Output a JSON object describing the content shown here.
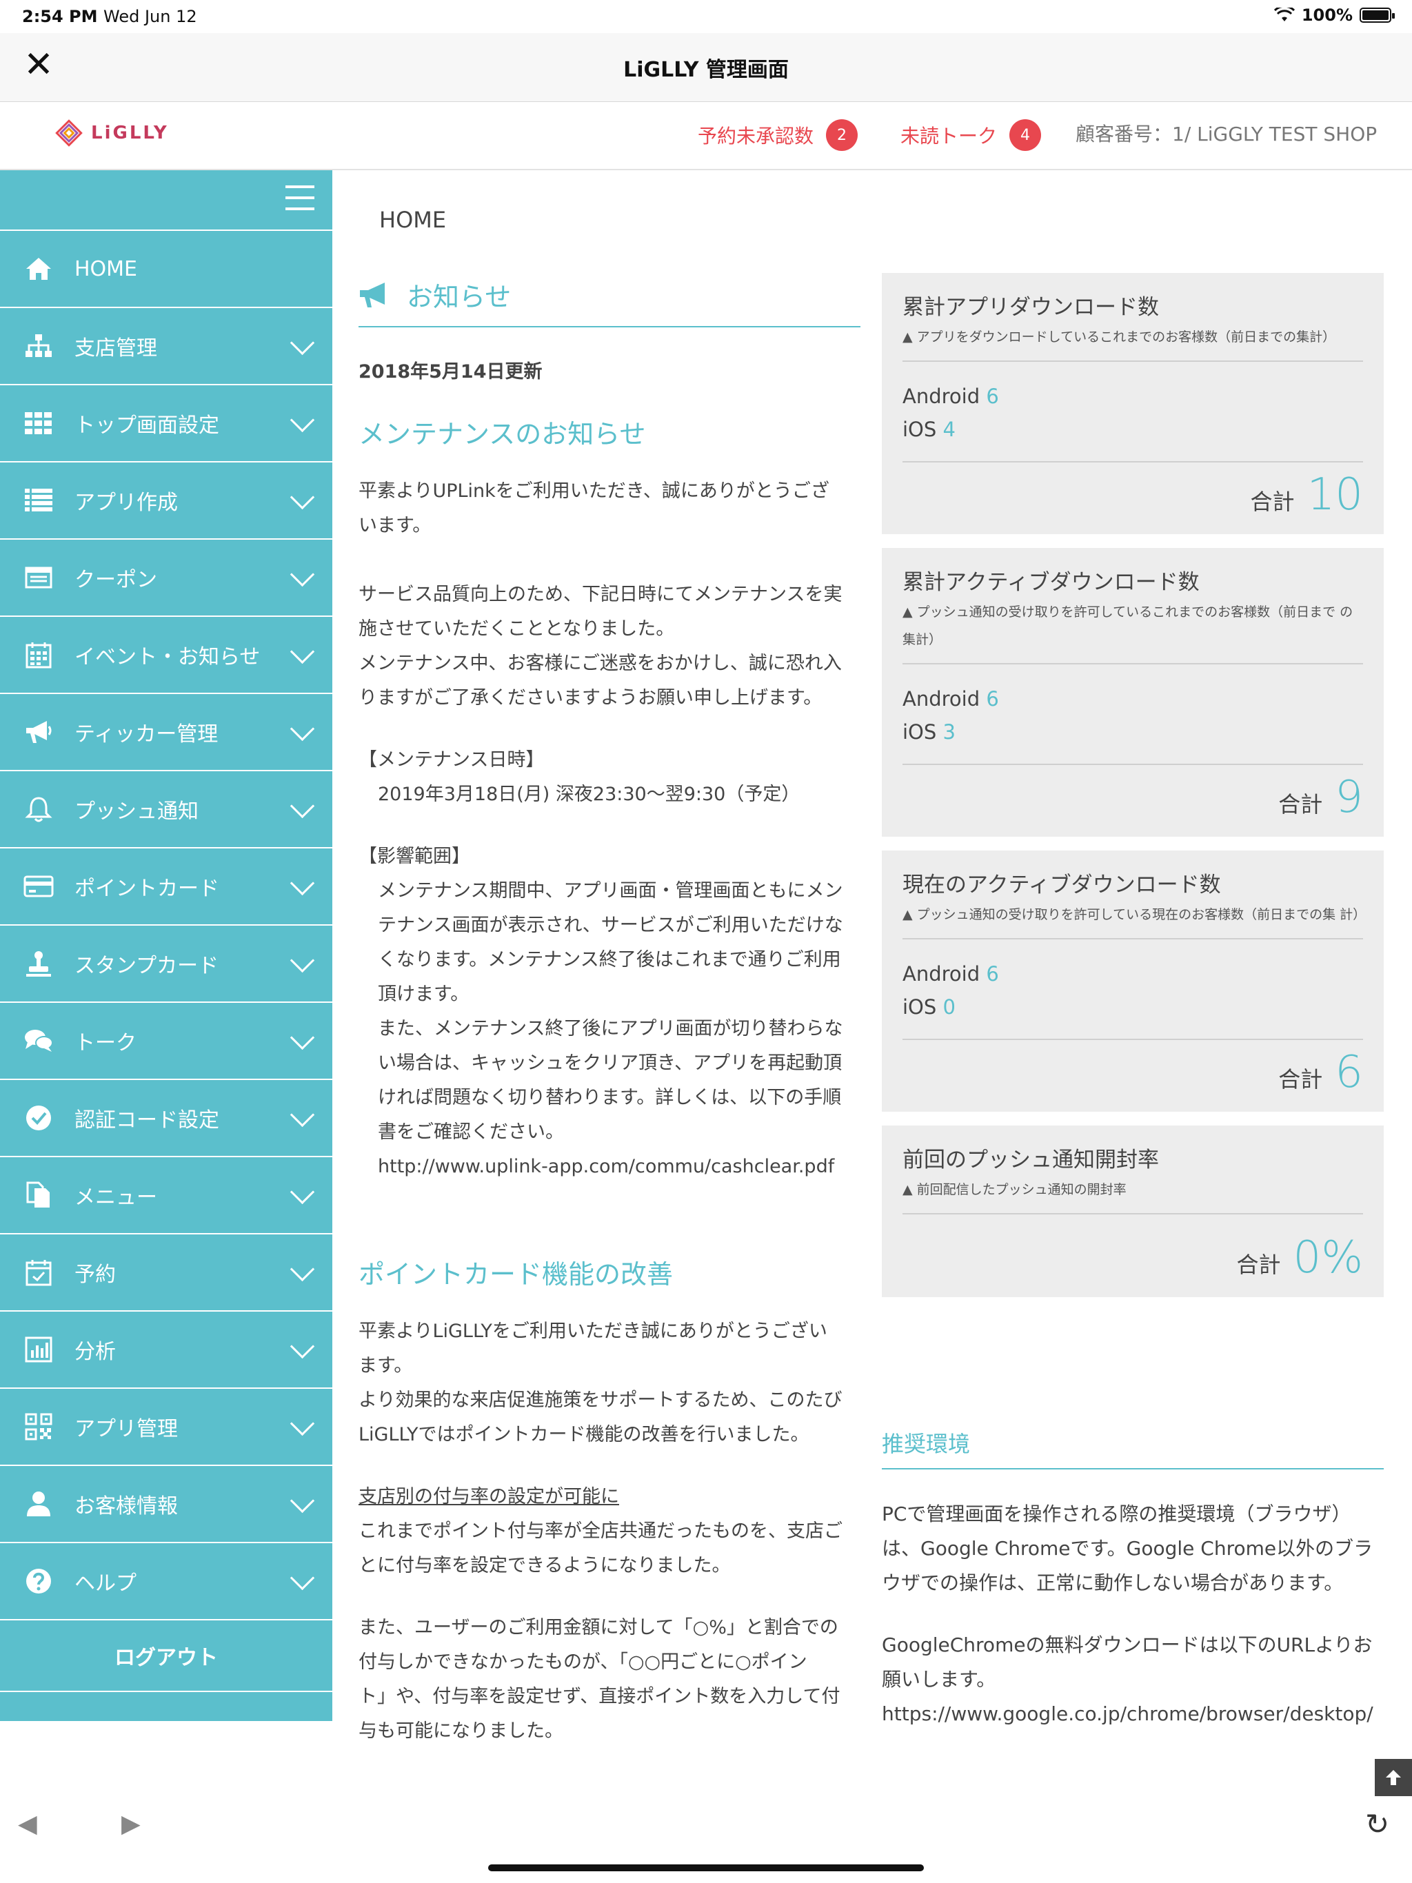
{
  "status_bar": {
    "time": "2:54 PM",
    "date": "Wed Jun 12",
    "battery": "100%"
  },
  "nav": {
    "title": "LiGLLY 管理画面"
  },
  "header": {
    "logo_text": "LiGLLY",
    "unconfirmed_label": "予約未承認数",
    "unconfirmed_count": "2",
    "unread_label": "未読トーク",
    "unread_count": "4",
    "customer": "顧客番号：1/ LiGGLY TEST SHOP"
  },
  "sidebar": {
    "items": [
      {
        "label": "HOME",
        "icon": "home-icon"
      },
      {
        "label": "支店管理",
        "icon": "sitemap-icon"
      },
      {
        "label": "トップ画面設定",
        "icon": "grid-icon"
      },
      {
        "label": "アプリ作成",
        "icon": "list-icon"
      },
      {
        "label": "クーポン",
        "icon": "coupon-icon"
      },
      {
        "label": "イベント・お知らせ",
        "icon": "calendar-icon"
      },
      {
        "label": "ティッカー管理",
        "icon": "megaphone-icon"
      },
      {
        "label": "プッシュ通知",
        "icon": "bell-icon"
      },
      {
        "label": "ポイントカード",
        "icon": "credit-card-icon"
      },
      {
        "label": "スタンプカード",
        "icon": "stamp-icon"
      },
      {
        "label": "トーク",
        "icon": "chat-icon"
      },
      {
        "label": "認証コード設定",
        "icon": "check-circle-icon"
      },
      {
        "label": "メニュー",
        "icon": "copy-icon"
      },
      {
        "label": "予約",
        "icon": "calendar-check-icon"
      },
      {
        "label": "分析",
        "icon": "bar-chart-icon"
      },
      {
        "label": "アプリ管理",
        "icon": "qr-code-icon"
      },
      {
        "label": "お客様情報",
        "icon": "user-icon"
      },
      {
        "label": "ヘルプ",
        "icon": "question-icon"
      }
    ],
    "logout": "ログアウト"
  },
  "main": {
    "breadcrumb": "HOME",
    "news": {
      "title": "お知らせ",
      "updated": "2018年5月14日更新",
      "h1": "メンテナンスのお知らせ",
      "p1a": "平素よりUPLinkをご利用いただき、誠にありがとうござ",
      "p1b": "います。",
      "p2a": "サービス品質向上のため、下記日時にてメンテナンスを実",
      "p2b": "施させていただくこととなりました。",
      "p2c": "メンテナンス中、お客様にご迷惑をおかけし、誠に恐れ入",
      "p2d": "りますがご了承くださいますようお願い申し上げます。",
      "dt_label": "【メンテナンス日時】",
      "dt_value": "2019年3月18日(月) 深夜23:30〜翌9:30（予定）",
      "scope_label": "【影響範囲】",
      "s1": "メンテナンス期間中、アプリ画面・管理画面ともにメン",
      "s2": "テナンス画面が表示され、サービスがご利用いただけな",
      "s3": "くなります。メンテナンス終了後はこれまで通りご利用",
      "s4": "頂けます。",
      "s5": "また、メンテナンス終了後にアプリ画面が切り替わらな",
      "s6": "い場合は、キャッシュをクリア頂き、アプリを再起動頂",
      "s7": "ければ問題なく切り替わります。詳しくは、以下の手順",
      "s8": "書をご確認ください。",
      "link": "http://www.uplink-app.com/commu/cashclear.pdf",
      "h2": "ポイントカード機能の改善",
      "q1": "平素よりLiGLLYをご利用いただき誠にありがとうござい",
      "q2": "ます。",
      "q3": "より効果的な来店促進施策をサポートするため、このたび",
      "q4": "LiGLLYではポイントカード機能の改善を行いました。",
      "sub": "支店別の付与率の設定が可能に",
      "r1": "これまでポイント付与率が全店共通だったものを、支店ご",
      "r2": "とに付与率を設定できるようになりました。",
      "t1": "また、ユーザーのご利用金額に対して「○%」と割合での",
      "t2": "付与しかできなかったものが、「○○円ごとに○ポイン",
      "t3": "ト」や、付与率を設定せず、直接ポイント数を入力して付",
      "t4": "与も可能になりました。"
    },
    "stats": [
      {
        "title": "累計アプリダウンロード数",
        "sub": "▲ アプリをダウンロードしているこれまでのお客様数（前日までの集計）",
        "android_label": "Android",
        "android": "6",
        "ios_label": "iOS",
        "ios": "4",
        "total_label": "合計",
        "total": "10"
      },
      {
        "title": "累計アクティブダウンロード数",
        "sub": "▲ プッシュ通知の受け取りを許可しているこれまでのお客様数（前日まで の集計）",
        "android_label": "Android",
        "android": "6",
        "ios_label": "iOS",
        "ios": "3",
        "total_label": "合計",
        "total": "9"
      },
      {
        "title": "現在のアクティブダウンロード数",
        "sub": "▲ プッシュ通知の受け取りを許可している現在のお客様数（前日までの集 計）",
        "android_label": "Android",
        "android": "6",
        "ios_label": "iOS",
        "ios": "0",
        "total_label": "合計",
        "total": "6"
      },
      {
        "title": "前回のプッシュ通知開封率",
        "sub": "▲ 前回配信したプッシュ通知の開封率",
        "total_label": "合計",
        "total": "0%"
      }
    ],
    "recommend": {
      "title": "推奨環境",
      "p1a": "PCで管理画面を操作される際の推奨環境（ブラウザ）",
      "p1b": "は、Google Chromeです。Google Chrome以外のブラ",
      "p1c": "ウザでの操作は、正常に動作しない場合があります。",
      "p2a": "GoogleChromeの無料ダウンロードは以下のURLよりお",
      "p2b": "願いします。",
      "link": "https://www.google.co.jp/chrome/browser/desktop/"
    }
  }
}
